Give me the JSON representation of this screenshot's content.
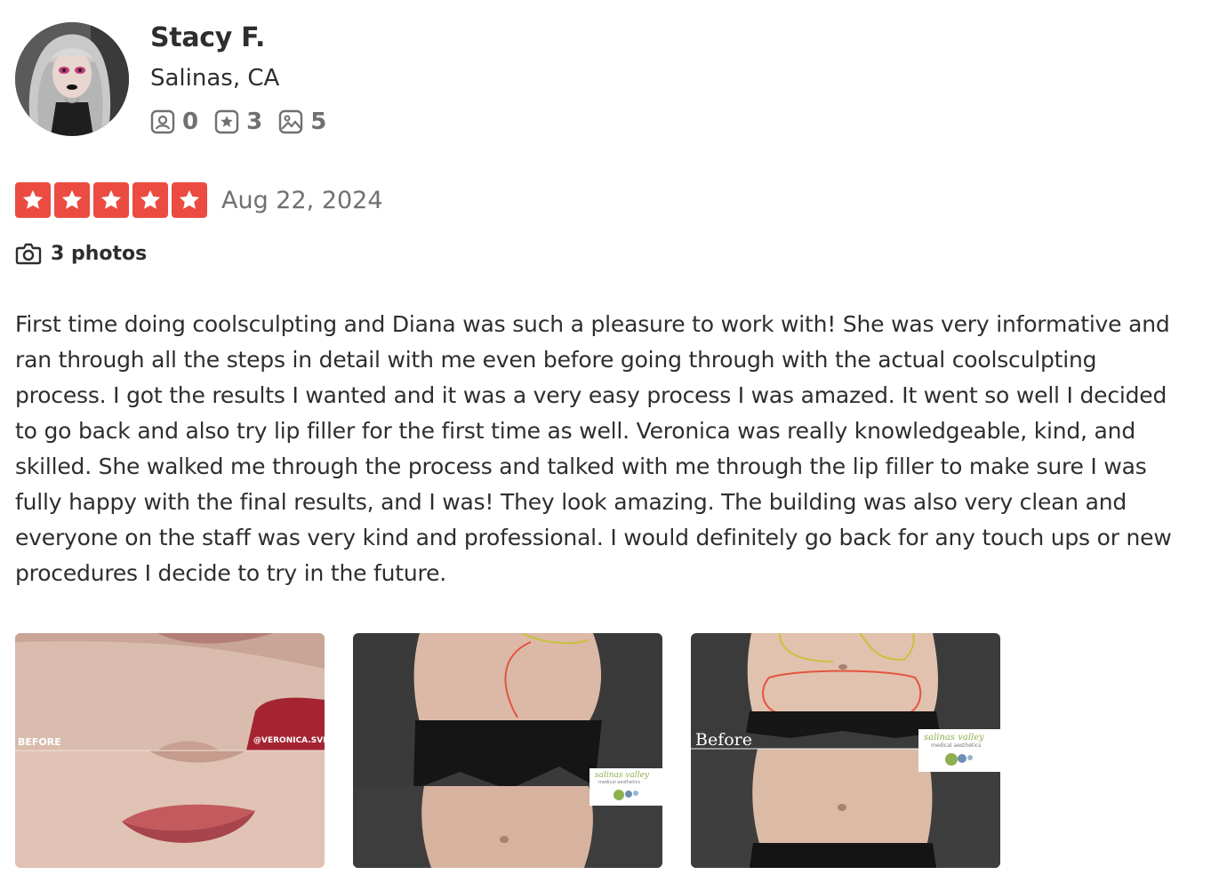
{
  "user": {
    "name": "Stacy F.",
    "location": "Salinas, CA",
    "stats": [
      {
        "icon": "friends-icon",
        "value": "0"
      },
      {
        "icon": "review-star-icon",
        "value": "3"
      },
      {
        "icon": "photo-icon",
        "value": "5"
      }
    ]
  },
  "review": {
    "rating": 5,
    "date": "Aug 22, 2024",
    "photos_label": "3 photos",
    "text": "First time doing coolsculpting and Diana was such a pleasure to work with! She was very informative and ran through all the steps in detail with me even before going through with the actual coolsculpting process. I got the results I wanted and it was a very easy process I was amazed. It went so well I decided to go back and also try lip filler for the first time as well. Veronica was really knowledgeable, kind, and skilled. She walked me through the process and talked with me through the lip filler to make sure I was fully happy with the final results, and I was! They look amazing. The building was also very clean and everyone on the staff was very kind and professional. I would definitely go back for any touch ups or new procedures I decide to try in the future."
  },
  "photos": [
    {
      "caption_left": "BEFORE",
      "caption_right": "@VERONICA.SVMA"
    },
    {
      "watermark_line1": "salinas valley",
      "watermark_line2": "medical aesthetics"
    },
    {
      "caption_left": "Before",
      "watermark_line1": "salinas valley",
      "watermark_line2": "medical aesthetics"
    }
  ],
  "colors": {
    "star_red": "#eb4b40",
    "text_primary": "#2d2e2f",
    "text_secondary": "#6e7072"
  }
}
